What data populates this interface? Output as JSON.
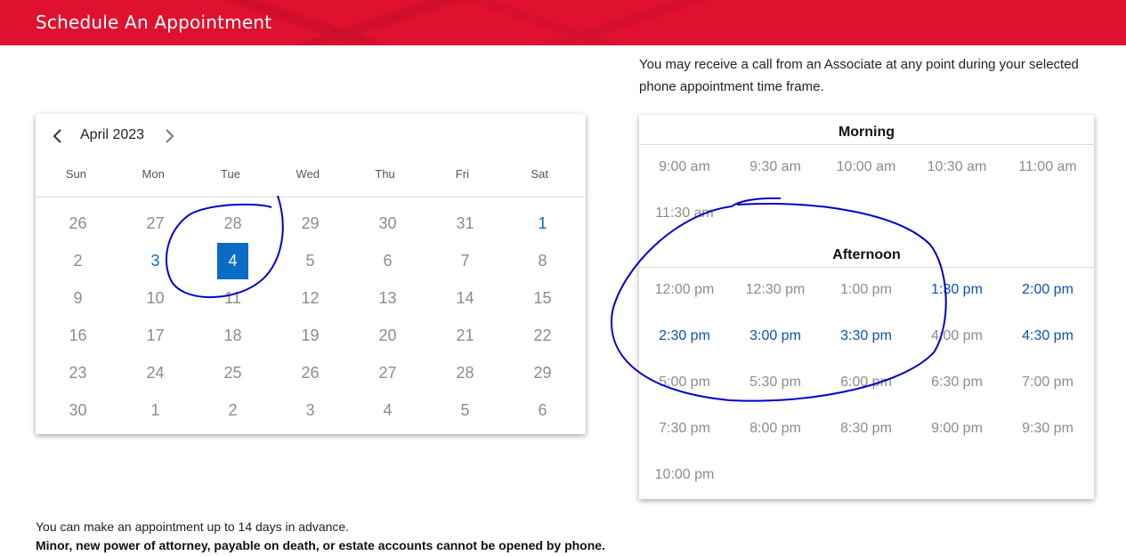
{
  "header": {
    "title": "Schedule An Appointment"
  },
  "calendar": {
    "month_label": "April 2023",
    "weekdays": [
      "Sun",
      "Mon",
      "Tue",
      "Wed",
      "Thu",
      "Fri",
      "Sat"
    ],
    "weeks": [
      [
        {
          "d": "26",
          "s": "off"
        },
        {
          "d": "27",
          "s": "off"
        },
        {
          "d": "28",
          "s": "off"
        },
        {
          "d": "29",
          "s": "off"
        },
        {
          "d": "30",
          "s": "off"
        },
        {
          "d": "31",
          "s": "off"
        },
        {
          "d": "1",
          "s": "avail"
        }
      ],
      [
        {
          "d": "2",
          "s": "off"
        },
        {
          "d": "3",
          "s": "avail"
        },
        {
          "d": "4",
          "s": "selected"
        },
        {
          "d": "5",
          "s": "off"
        },
        {
          "d": "6",
          "s": "off"
        },
        {
          "d": "7",
          "s": "off"
        },
        {
          "d": "8",
          "s": "off"
        }
      ],
      [
        {
          "d": "9",
          "s": "off"
        },
        {
          "d": "10",
          "s": "off"
        },
        {
          "d": "11",
          "s": "off"
        },
        {
          "d": "12",
          "s": "off"
        },
        {
          "d": "13",
          "s": "off"
        },
        {
          "d": "14",
          "s": "off"
        },
        {
          "d": "15",
          "s": "off"
        }
      ],
      [
        {
          "d": "16",
          "s": "off"
        },
        {
          "d": "17",
          "s": "off"
        },
        {
          "d": "18",
          "s": "off"
        },
        {
          "d": "19",
          "s": "off"
        },
        {
          "d": "20",
          "s": "off"
        },
        {
          "d": "21",
          "s": "off"
        },
        {
          "d": "22",
          "s": "off"
        }
      ],
      [
        {
          "d": "23",
          "s": "off"
        },
        {
          "d": "24",
          "s": "off"
        },
        {
          "d": "25",
          "s": "off"
        },
        {
          "d": "26",
          "s": "off"
        },
        {
          "d": "27",
          "s": "off"
        },
        {
          "d": "28",
          "s": "off"
        },
        {
          "d": "29",
          "s": "off"
        }
      ],
      [
        {
          "d": "30",
          "s": "off"
        },
        {
          "d": "1",
          "s": "off"
        },
        {
          "d": "2",
          "s": "off"
        },
        {
          "d": "3",
          "s": "off"
        },
        {
          "d": "4",
          "s": "off"
        },
        {
          "d": "5",
          "s": "off"
        },
        {
          "d": "6",
          "s": "off"
        }
      ]
    ]
  },
  "info_text": "You may receive a call from an Associate at any point during your selected phone appointment time frame.",
  "morning": {
    "title": "Morning",
    "slots": [
      {
        "t": "9:00 am",
        "avail": false
      },
      {
        "t": "9:30 am",
        "avail": false
      },
      {
        "t": "10:00 am",
        "avail": false
      },
      {
        "t": "10:30 am",
        "avail": false
      },
      {
        "t": "11:00 am",
        "avail": false
      },
      {
        "t": "11:30 am",
        "avail": false
      }
    ]
  },
  "afternoon": {
    "title": "Afternoon",
    "slots": [
      {
        "t": "12:00 pm",
        "avail": false
      },
      {
        "t": "12:30 pm",
        "avail": false
      },
      {
        "t": "1:00 pm",
        "avail": false
      },
      {
        "t": "1:30 pm",
        "avail": true
      },
      {
        "t": "2:00 pm",
        "avail": true
      },
      {
        "t": "2:30 pm",
        "avail": true
      },
      {
        "t": "3:00 pm",
        "avail": true
      },
      {
        "t": "3:30 pm",
        "avail": true
      },
      {
        "t": "4:00 pm",
        "avail": false
      },
      {
        "t": "4:30 pm",
        "avail": true
      },
      {
        "t": "5:00 pm",
        "avail": false
      },
      {
        "t": "5:30 pm",
        "avail": false
      },
      {
        "t": "6:00 pm",
        "avail": false
      },
      {
        "t": "6:30 pm",
        "avail": false
      },
      {
        "t": "7:00 pm",
        "avail": false
      },
      {
        "t": "7:30 pm",
        "avail": false
      },
      {
        "t": "8:00 pm",
        "avail": false
      },
      {
        "t": "8:30 pm",
        "avail": false
      },
      {
        "t": "9:00 pm",
        "avail": false
      },
      {
        "t": "9:30 pm",
        "avail": false
      },
      {
        "t": "10:00 pm",
        "avail": false
      }
    ]
  },
  "footer": {
    "note": "You can make an appointment up to 14 days in advance.",
    "warning": "Minor, new power of attorney, payable on death, or estate accounts cannot be opened by phone."
  },
  "colors": {
    "brand_red": "#e0112f",
    "accent_blue": "#0a6cc4",
    "annotation_ink": "#0000cc"
  },
  "icons": {
    "prev": "chevron-left-icon",
    "next": "chevron-right-icon"
  }
}
